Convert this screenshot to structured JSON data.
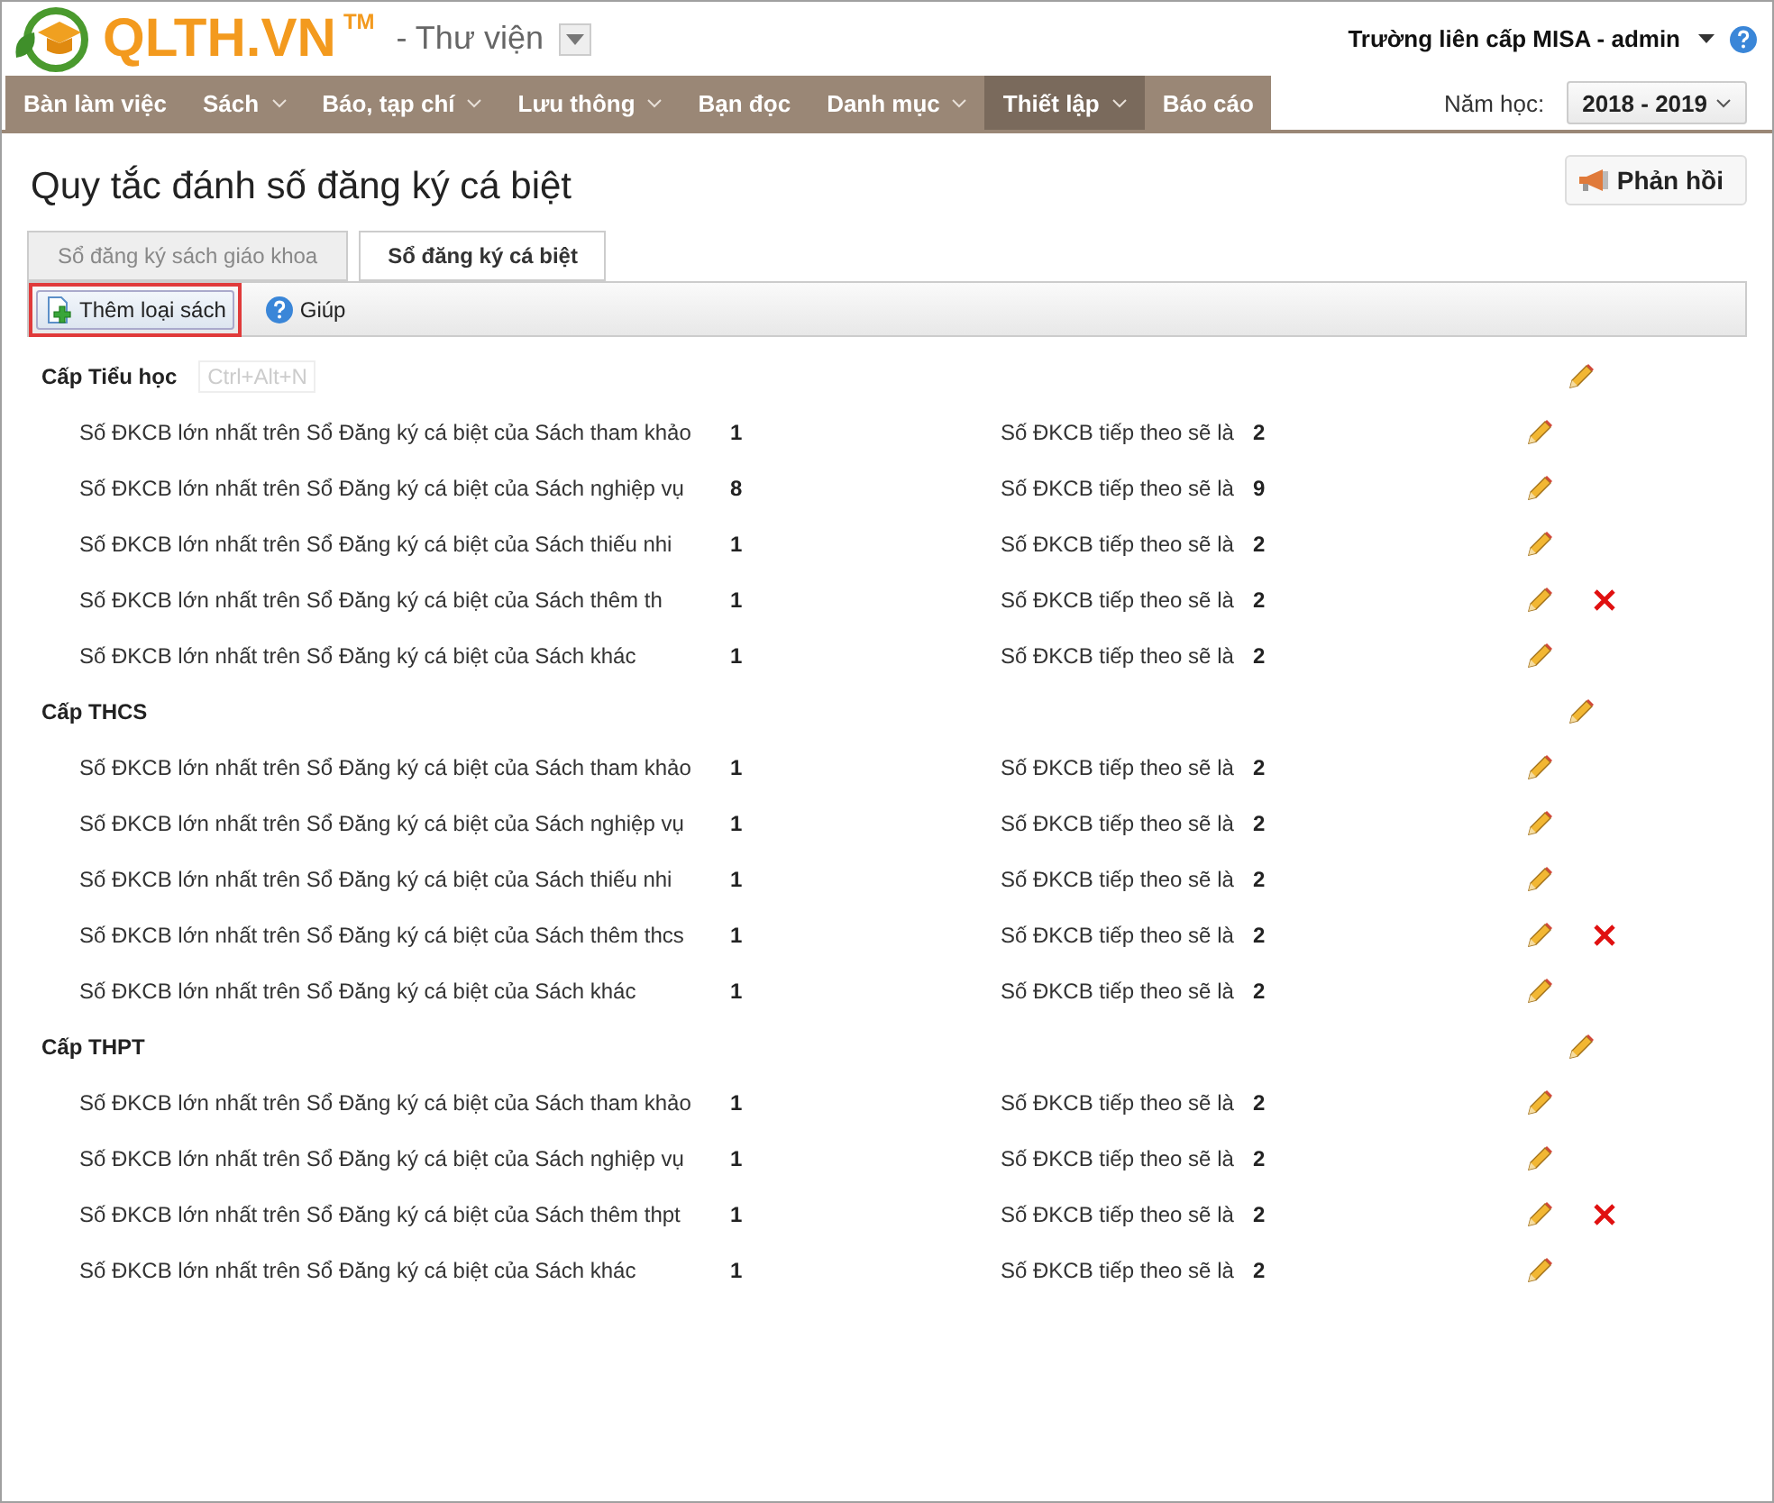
{
  "header": {
    "logo": "QLTH.VN",
    "trademark": "TM",
    "module": "- Thư viện",
    "user": "Trường liên cấp MISA - admin"
  },
  "nav": [
    {
      "label": "Bàn làm việc",
      "dropdown": false,
      "selected": false
    },
    {
      "label": "Sách",
      "dropdown": true,
      "selected": false
    },
    {
      "label": "Báo, tạp chí",
      "dropdown": true,
      "selected": false
    },
    {
      "label": "Lưu thông",
      "dropdown": true,
      "selected": false
    },
    {
      "label": "Bạn đọc",
      "dropdown": false,
      "selected": false
    },
    {
      "label": "Danh mục",
      "dropdown": true,
      "selected": false
    },
    {
      "label": "Thiết lập",
      "dropdown": true,
      "selected": true
    },
    {
      "label": "Báo cáo",
      "dropdown": false,
      "selected": false
    }
  ],
  "school_year": {
    "label": "Năm học:",
    "value": "2018 - 2019"
  },
  "page_title": "Quy tắc đánh số đăng ký cá biệt",
  "feedback_button": "Phản hồi",
  "tabs": [
    {
      "label": "Sổ đăng ký sách giáo khoa",
      "selected": false
    },
    {
      "label": "Sổ đăng ký cá biệt",
      "selected": true
    }
  ],
  "toolbar": [
    {
      "kind": "add",
      "label": "Thêm loại sách",
      "highlighted": true
    },
    {
      "kind": "help",
      "label": "Giúp",
      "highlighted": false
    }
  ],
  "tooltip": "Ctrl+Alt+N",
  "groups": [
    {
      "name": "Cấp Tiểu học",
      "rows": [
        {
          "label": "Số ĐKCB lớn nhất trên Sổ Đăng ký cá biệt của Sách tham khảo",
          "max": "1",
          "next_label": "Số ĐKCB tiếp theo sẽ là",
          "next": "2",
          "deletable": false
        },
        {
          "label": "Số ĐKCB lớn nhất trên Sổ Đăng ký cá biệt của Sách nghiệp vụ",
          "max": "8",
          "next_label": "Số ĐKCB tiếp theo sẽ là",
          "next": "9",
          "deletable": false
        },
        {
          "label": "Số ĐKCB lớn nhất trên Sổ Đăng ký cá biệt của Sách thiếu nhi",
          "max": "1",
          "next_label": "Số ĐKCB tiếp theo sẽ là",
          "next": "2",
          "deletable": false
        },
        {
          "label": "Số ĐKCB lớn nhất trên Sổ Đăng ký cá biệt của Sách thêm th",
          "max": "1",
          "next_label": "Số ĐKCB tiếp theo sẽ là",
          "next": "2",
          "deletable": true
        },
        {
          "label": "Số ĐKCB lớn nhất trên Sổ Đăng ký cá biệt của Sách khác",
          "max": "1",
          "next_label": "Số ĐKCB tiếp theo sẽ là",
          "next": "2",
          "deletable": false
        }
      ]
    },
    {
      "name": "Cấp THCS",
      "rows": [
        {
          "label": "Số ĐKCB lớn nhất trên Sổ Đăng ký cá biệt của Sách tham khảo",
          "max": "1",
          "next_label": "Số ĐKCB tiếp theo sẽ là",
          "next": "2",
          "deletable": false
        },
        {
          "label": "Số ĐKCB lớn nhất trên Sổ Đăng ký cá biệt của Sách nghiệp vụ",
          "max": "1",
          "next_label": "Số ĐKCB tiếp theo sẽ là",
          "next": "2",
          "deletable": false
        },
        {
          "label": "Số ĐKCB lớn nhất trên Sổ Đăng ký cá biệt của Sách thiếu nhi",
          "max": "1",
          "next_label": "Số ĐKCB tiếp theo sẽ là",
          "next": "2",
          "deletable": false
        },
        {
          "label": "Số ĐKCB lớn nhất trên Sổ Đăng ký cá biệt của Sách thêm thcs",
          "max": "1",
          "next_label": "Số ĐKCB tiếp theo sẽ là",
          "next": "2",
          "deletable": true
        },
        {
          "label": "Số ĐKCB lớn nhất trên Sổ Đăng ký cá biệt của Sách khác",
          "max": "1",
          "next_label": "Số ĐKCB tiếp theo sẽ là",
          "next": "2",
          "deletable": false
        }
      ]
    },
    {
      "name": "Cấp THPT",
      "rows": [
        {
          "label": "Số ĐKCB lớn nhất trên Sổ Đăng ký cá biệt của Sách tham khảo",
          "max": "1",
          "next_label": "Số ĐKCB tiếp theo sẽ là",
          "next": "2",
          "deletable": false
        },
        {
          "label": "Số ĐKCB lớn nhất trên Sổ Đăng ký cá biệt của Sách nghiệp vụ",
          "max": "1",
          "next_label": "Số ĐKCB tiếp theo sẽ là",
          "next": "2",
          "deletable": false
        },
        {
          "label": "Số ĐKCB lớn nhất trên Sổ Đăng ký cá biệt của Sách thêm thpt",
          "max": "1",
          "next_label": "Số ĐKCB tiếp theo sẽ là",
          "next": "2",
          "deletable": true
        },
        {
          "label": "Số ĐKCB lớn nhất trên Sổ Đăng ký cá biệt của Sách khác",
          "max": "1",
          "next_label": "Số ĐKCB tiếp theo sẽ là",
          "next": "2",
          "deletable": false
        }
      ]
    }
  ]
}
